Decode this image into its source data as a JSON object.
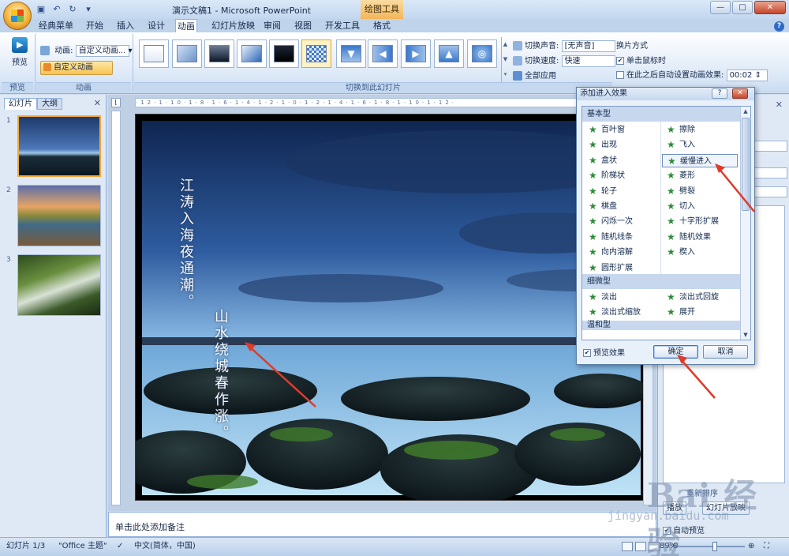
{
  "titlebar": {
    "title": "演示文稿1 - Microsoft PowerPoint",
    "context_tool": "绘图工具",
    "min": "—",
    "max": "□",
    "close": "✕"
  },
  "tabs": [
    "经典菜单",
    "开始",
    "插入",
    "设计",
    "动画",
    "幻灯片放映",
    "审阅",
    "视图",
    "开发工具",
    "格式"
  ],
  "ribbon": {
    "preview_label": "预览",
    "preview_group": "预览",
    "animation_label": "动画:",
    "animation_value": "自定义动画...",
    "custom_anim_label": "自定义动画",
    "animation_group": "动画",
    "transition_group": "切换到此幻灯片",
    "sound_label": "切换声音:",
    "sound_value": "[无声音]",
    "speed_label": "切换速度:",
    "speed_value": "快速",
    "apply_all": "全部应用",
    "advance_title": "换片方式",
    "on_click": "单击鼠标时",
    "auto_after": "在此之后自动设置动画效果:",
    "auto_time": "00:02"
  },
  "left_panel": {
    "tab_slides": "幻灯片",
    "tab_outline": "大纲",
    "close": "✕",
    "slides": [
      "1",
      "2",
      "3"
    ]
  },
  "slide": {
    "line1": "江涛入海夜通潮。",
    "line2": "山水绕城春作涨。"
  },
  "notes_placeholder": "单击此处添加备注",
  "task_pane": {
    "close": "✕",
    "reorder": "重新排序",
    "play": "播放",
    "slideshow": "幻灯片放映",
    "autopreview": "自动预览"
  },
  "statusbar": {
    "slide_counter": "幻灯片 1/3",
    "theme": "\"Office 主题\"",
    "language": "中文(简体，中国)",
    "zoom": "89%"
  },
  "dialog": {
    "title": "添加进入效果",
    "help": "?",
    "close": "✕",
    "category_basic": "基本型",
    "effects_left": [
      "百叶窗",
      "出现",
      "盒状",
      "阶梯状",
      "轮子",
      "棋盘",
      "闪烁一次",
      "随机线条",
      "向内溶解",
      "圆形扩展"
    ],
    "effects_right": [
      "擦除",
      "飞入",
      "缓慢进入",
      "菱形",
      "劈裂",
      "切入",
      "十字形扩展",
      "随机效果",
      "楔入"
    ],
    "category_subtle": "细微型",
    "subtle_left": [
      "淡出",
      "淡出式缩放"
    ],
    "subtle_right": [
      "淡出式回旋",
      "展开"
    ],
    "category_next": "温和型",
    "preview_effect": "预览效果",
    "ok": "确定",
    "cancel": "取消"
  },
  "watermark": {
    "brand": "Bai 经验",
    "url": "jingyan.baidu.com"
  }
}
